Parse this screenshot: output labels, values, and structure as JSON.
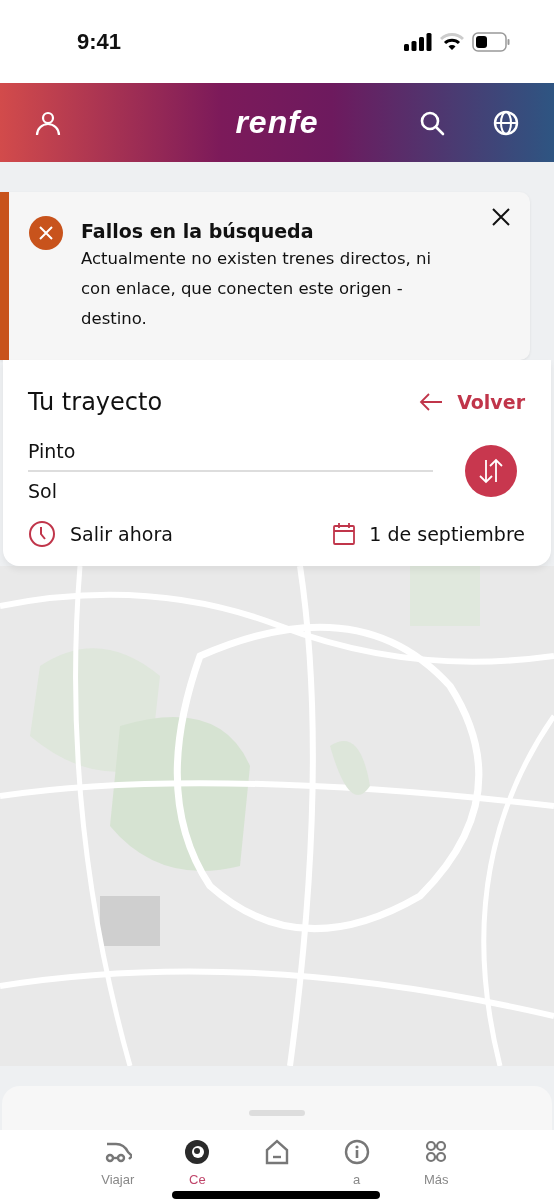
{
  "status_bar": {
    "time": "9:41"
  },
  "header": {
    "logo": "renfe"
  },
  "alert": {
    "title": "Fallos en la búsqueda",
    "message": "Actualmente no existen trenes directos, ni con enlace, que conecten este origen - destino."
  },
  "journey": {
    "title": "Tu trayecto",
    "back_link": "Volver",
    "origin": "Pinto",
    "destination": "Sol",
    "time": "Salir ahora",
    "date": "1 de septiembre"
  },
  "nav": [
    {
      "label": "Viajar",
      "selected": false
    },
    {
      "label": "Ce",
      "selected": true
    },
    {
      "selected": false
    },
    {
      "label": "a",
      "selected": false
    },
    {
      "label": "Más",
      "selected": false
    }
  ]
}
